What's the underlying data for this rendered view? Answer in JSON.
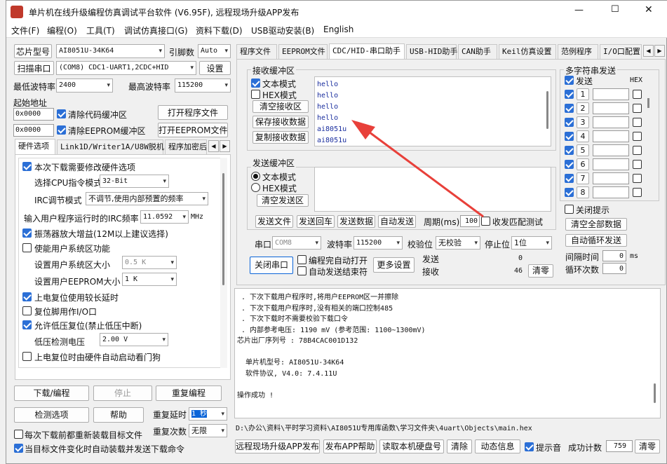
{
  "window": {
    "title": "单片机在线升级编程仿真调试平台软件 (V6.95F), 远程现场升级APP发布",
    "controls": {
      "minimize": "—",
      "maximize": "☐",
      "close": "✕"
    }
  },
  "menu": [
    "文件(F)",
    "编程(O)",
    "工具(T)",
    "调试仿真接口(G)",
    "资料下载(D)",
    "USB驱动安装(B)",
    "English"
  ],
  "left": {
    "chip_model_label": "芯片型号",
    "chip_model_value": "AI8051U-34K64",
    "pins_label": "引脚数",
    "pins_value": "Auto",
    "scan_port_label": "扫描串口",
    "port_value": "(COM8) CDC1-UART1,2CDC+HID",
    "settings_label": "设置",
    "min_baud_label": "最低波特率",
    "min_baud_value": "2400",
    "max_baud_label": "最高波特率",
    "max_baud_value": "115200",
    "start_addr_label": "起始地址",
    "addr1": "0x0000",
    "clear_code_label": "清除代码缓冲区",
    "open_program_label": "打开程序文件",
    "addr2": "0x0000",
    "clear_eeprom_label": "清除EEPROM缓冲区",
    "open_eeprom_label": "打开EEPROM文件",
    "tabs": [
      "硬件选项",
      "Link1D/Writer1A/U8W脱机",
      "程序加密后"
    ],
    "hw": {
      "modify_label": "本次下载需要修改硬件选项",
      "cpu_label": "选择CPU指令模式",
      "cpu_value": "32-Bit",
      "irc_mode_label": "IRC调节模式",
      "irc_mode_value": "不调节,使用内部预置的频率",
      "freq_label": "输入用户程序运行时的IRC频率",
      "freq_value": "11.0592",
      "freq_unit": "MHz",
      "osc_label": "振荡器放大增益(12M以上建议选择)",
      "sysarea_label": "使能用户系统区功能",
      "sysarea_size_label": "设置用户系统区大小",
      "sysarea_size_value": "0.5 K",
      "eeprom_size_label": "设置用户EEPROM大小",
      "eeprom_size_value": "1   K",
      "reset_delay_label": "上电复位使用较长延时",
      "reset_pin_label": "复位脚用作I/O口",
      "lvr_label": "允许低压复位(禁止低压中断)",
      "lvd_label": "低压检测电压",
      "lvd_value": "2.00 V",
      "wdt_label": "上电复位时由硬件自动启动看门狗"
    },
    "download_label": "下载/编程",
    "stop_label": "停止",
    "reprogram_label": "重复编程",
    "check_label": "检测选项",
    "help_label": "帮助",
    "repeat_delay_label": "重复延时",
    "repeat_delay_value": "1 秒",
    "repeat_count_label": "重复次数",
    "repeat_count_value": "无限",
    "reload_label": "每次下载前都重新装载目标文件",
    "autoload_label": "当目标文件变化时自动装载并发送下载命令"
  },
  "right": {
    "tabs": [
      "程序文件",
      "EEPROM文件",
      "CDC/HID-串口助手",
      "USB-HID助手",
      "CAN助手",
      "Keil仿真设置",
      "范例程序",
      "I/O口配置"
    ],
    "recv_title": "接收缓冲区",
    "text_mode": "文本模式",
    "hex_mode": "HEX模式",
    "clear_recv": "清空接收区",
    "save_recv": "保存接收数据",
    "copy_recv": "复制接收数据",
    "recv_lines": [
      "hello",
      "hello",
      "hello",
      "hello",
      "ai8051u",
      "ai8051u"
    ],
    "send_title": "发送缓冲区",
    "send_text_mode": "文本模式",
    "send_hex_mode": "HEX模式",
    "clear_send": "清空发送区",
    "send_file": "发送文件",
    "send_return": "发送回车",
    "send_data": "发送数据",
    "auto_send": "自动发送",
    "period_label": "周期(ms)",
    "period_value": "100",
    "match_test": "收发匹配测试",
    "port_label": "串口",
    "port_value": "COM8",
    "baud_label": "波特率",
    "baud_value": "115200",
    "parity_label": "校验位",
    "parity_value": "无校验",
    "stop_label": "停止位",
    "stop_value": "1位",
    "close_port": "关闭串口",
    "auto_open": "编程完自动打开",
    "auto_stop": "自动发送结束符",
    "more_settings": "更多设置",
    "sent_label": "发送",
    "sent_value": "0",
    "recv_label": "接收",
    "recv_value": "46",
    "clear_counts": "清零",
    "multi_title": "多字符串发送",
    "multi_send": "发送",
    "multi_hex": "HEX",
    "multi_rows": [
      "1",
      "2",
      "3",
      "4",
      "5",
      "6",
      "7",
      "8"
    ],
    "close_tip": "关闭提示",
    "clear_all": "清空全部数据",
    "auto_loop": "自动循环发送",
    "interval_label": "间隔时间",
    "interval_value": "0",
    "interval_unit": "ms",
    "loop_count_label": "循环次数",
    "loop_count_value": "0"
  },
  "log": {
    "lines": [
      ". 下次下载用户程序时,将用户EEPROM区一并擦除",
      ". 下次下载用户程序时,没有相关的端口控制485",
      ". 下次下载时不需要校验下载口令",
      ". 内部参考电压: 1190 mV (参考范围: 1100~1300mV)",
      "芯片出厂序列号 : 78B4CAC001D132",
      "",
      "  单片机型号: AI8051U-34K64",
      "  软件协议, V4.0: 7.4.11U",
      "",
      "操作成功 !"
    ],
    "path": "D:\\办公\\资料\\平时学习资料\\AI8051U专用库函数\\学习文件夹\\4uart\\Objects\\main.hex"
  },
  "bottom": {
    "remote_upgrade": "远程现场升级APP发布",
    "publish_help": "发布APP帮助",
    "read_disk": "读取本机硬盘号",
    "clear": "清除",
    "anim": "动态信息",
    "beep": "提示音",
    "success_label": "成功计数",
    "success_value": "759",
    "clear_count": "清零"
  },
  "colors": {
    "accent": "#2b6fd6",
    "arrow": "#e8403a",
    "recv_text": "#1a2e9e"
  }
}
